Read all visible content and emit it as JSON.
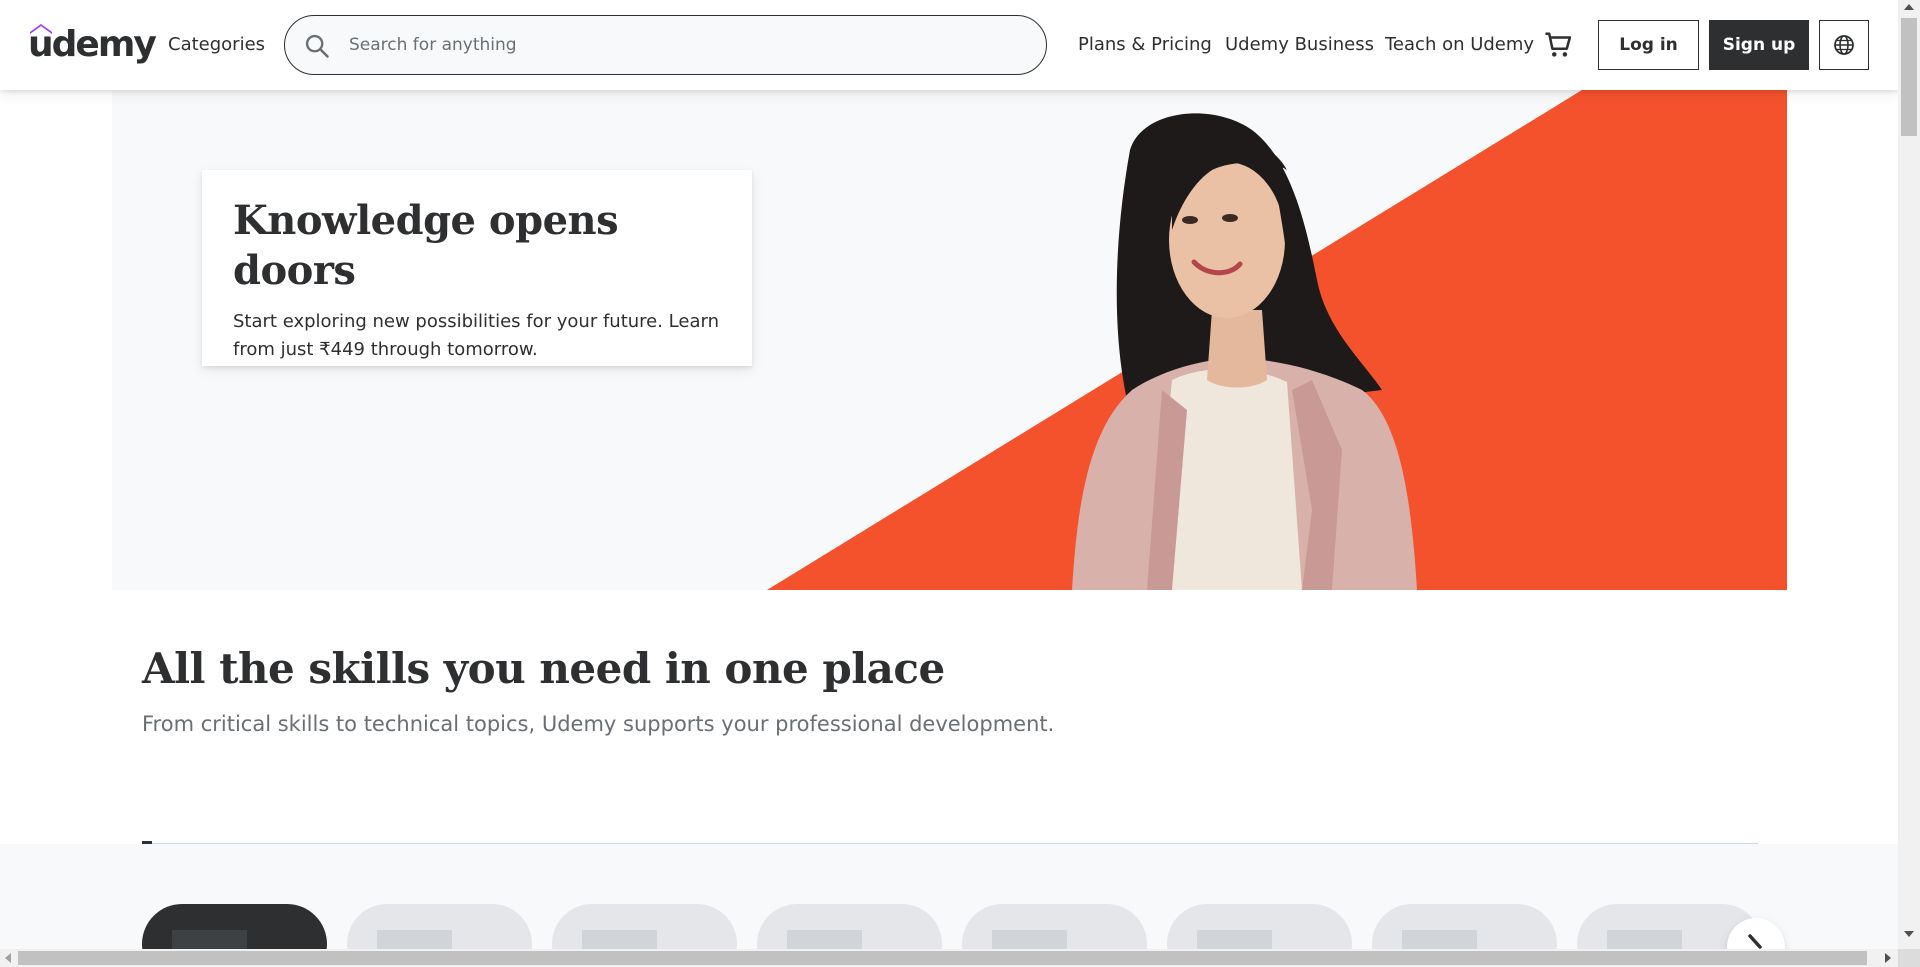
{
  "header": {
    "logo_text": "udemy",
    "categories_label": "Categories",
    "search": {
      "placeholder": "Search for anything",
      "value": ""
    },
    "nav_links": [
      "Plans & Pricing",
      "Udemy Business",
      "Teach on Udemy"
    ],
    "login_label": "Log in",
    "signup_label": "Sign up",
    "brand_color": "#a435f0"
  },
  "hero": {
    "title": "Knowledge opens doors",
    "text": "Start exploring new possibilities for your future. Learn from just ₹449 through tomorrow.",
    "accent_color": "#f4522d"
  },
  "skills": {
    "title": "All the skills you need in one place",
    "subtitle": "From critical skills to technical topics, Udemy supports your professional development."
  },
  "icons": {
    "search": "search-icon",
    "cart": "cart-icon",
    "language": "globe-icon",
    "carousel_next": "chevron-right-icon"
  }
}
